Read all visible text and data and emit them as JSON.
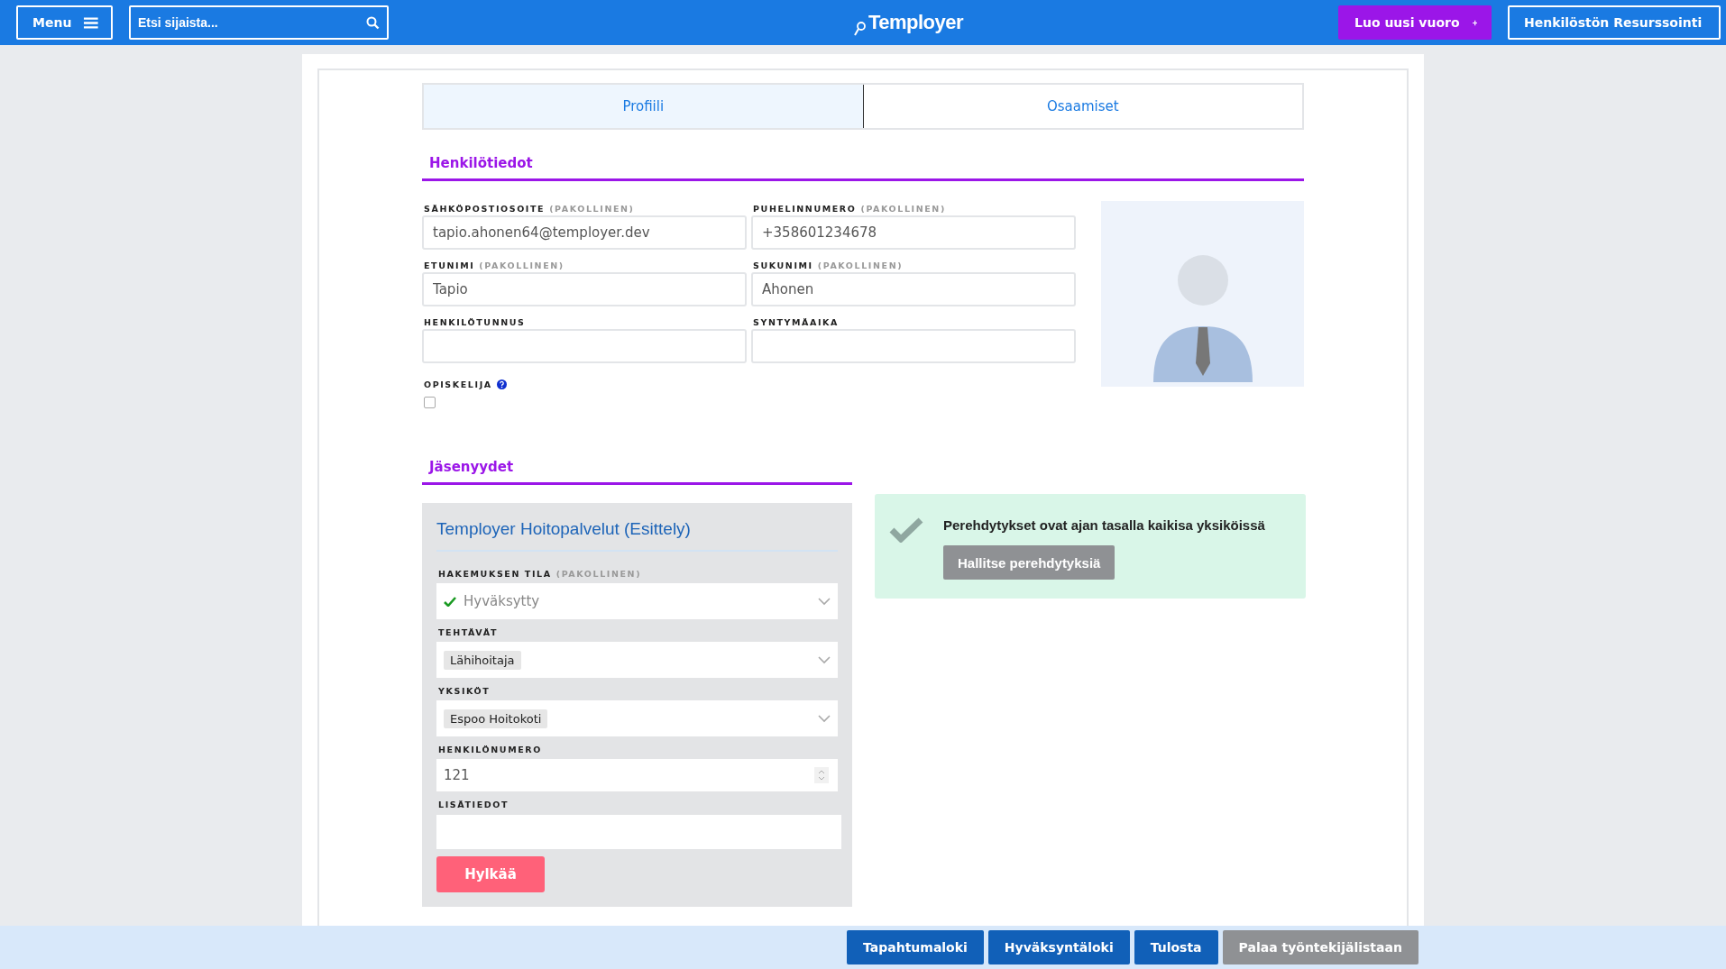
{
  "header": {
    "menu_button": "Menu",
    "search": {
      "placeholder": "Etsi sijaista..."
    },
    "logo": "Temployer",
    "new_shift_button": "Luo uusi vuoro",
    "resourcing_button": "Henkilöstön Resurssointi"
  },
  "tabs": [
    {
      "label": "Profiili",
      "selected": true
    },
    {
      "label": "Osaamiset",
      "selected": false
    }
  ],
  "personal": {
    "title": "Henkilötiedot",
    "fields": [
      {
        "label": "SÄHKÖPOSTIOSOITE",
        "required_note": "(PAKOLLINEN)",
        "value": "tapio.ahonen64@temployer.dev"
      },
      {
        "label": "PUHELINNUMERO",
        "required_note": "(PAKOLLINEN)",
        "value": "+358601234678"
      },
      {
        "label": "ETUNIMI",
        "required_note": "(PAKOLLINEN)",
        "value": "Tapio"
      },
      {
        "label": "SUKUNIMI",
        "required_note": "(PAKOLLINEN)",
        "value": "Ahonen"
      },
      {
        "label": "HENKILÖTUNNUS"
      },
      {
        "label": "SYNTYMÄAIKA"
      }
    ],
    "student": {
      "label": "OPISKELIJA",
      "checked": false
    }
  },
  "memberships": {
    "title": "Jäsenyydet",
    "card": {
      "organization": "Temployer Hoitopalvelut (Esittely)",
      "fields": [
        {
          "kind": "status",
          "label": "HAKEMUKSEN TILA",
          "required_note": "(PAKOLLINEN)",
          "value": "Hyväksytty"
        },
        {
          "kind": "tag",
          "label": "TEHTÄVÄT",
          "value": "Lähihoitaja"
        },
        {
          "kind": "tag",
          "label": "YKSIKÖT",
          "value": "Espoo Hoitokoti"
        },
        {
          "kind": "number",
          "label": "HENKILÖNUMERO",
          "value": "121"
        },
        {
          "kind": "text",
          "label": "LISÄTIEDOT"
        }
      ],
      "reject_button": "Hylkää"
    }
  },
  "notice": {
    "text": "Perehdytykset ovat ajan tasalla kaikisa yksiköissä",
    "button": "Hallitse perehdytyksiä"
  },
  "footer_buttons": [
    {
      "label": "Tapahtumaloki",
      "kind": "primary"
    },
    {
      "label": "Hyväksyntäloki",
      "kind": "primary"
    },
    {
      "label": "Tulosta",
      "kind": "primary"
    },
    {
      "label": "Palaa työntekijälistaan",
      "kind": "secondary"
    }
  ]
}
